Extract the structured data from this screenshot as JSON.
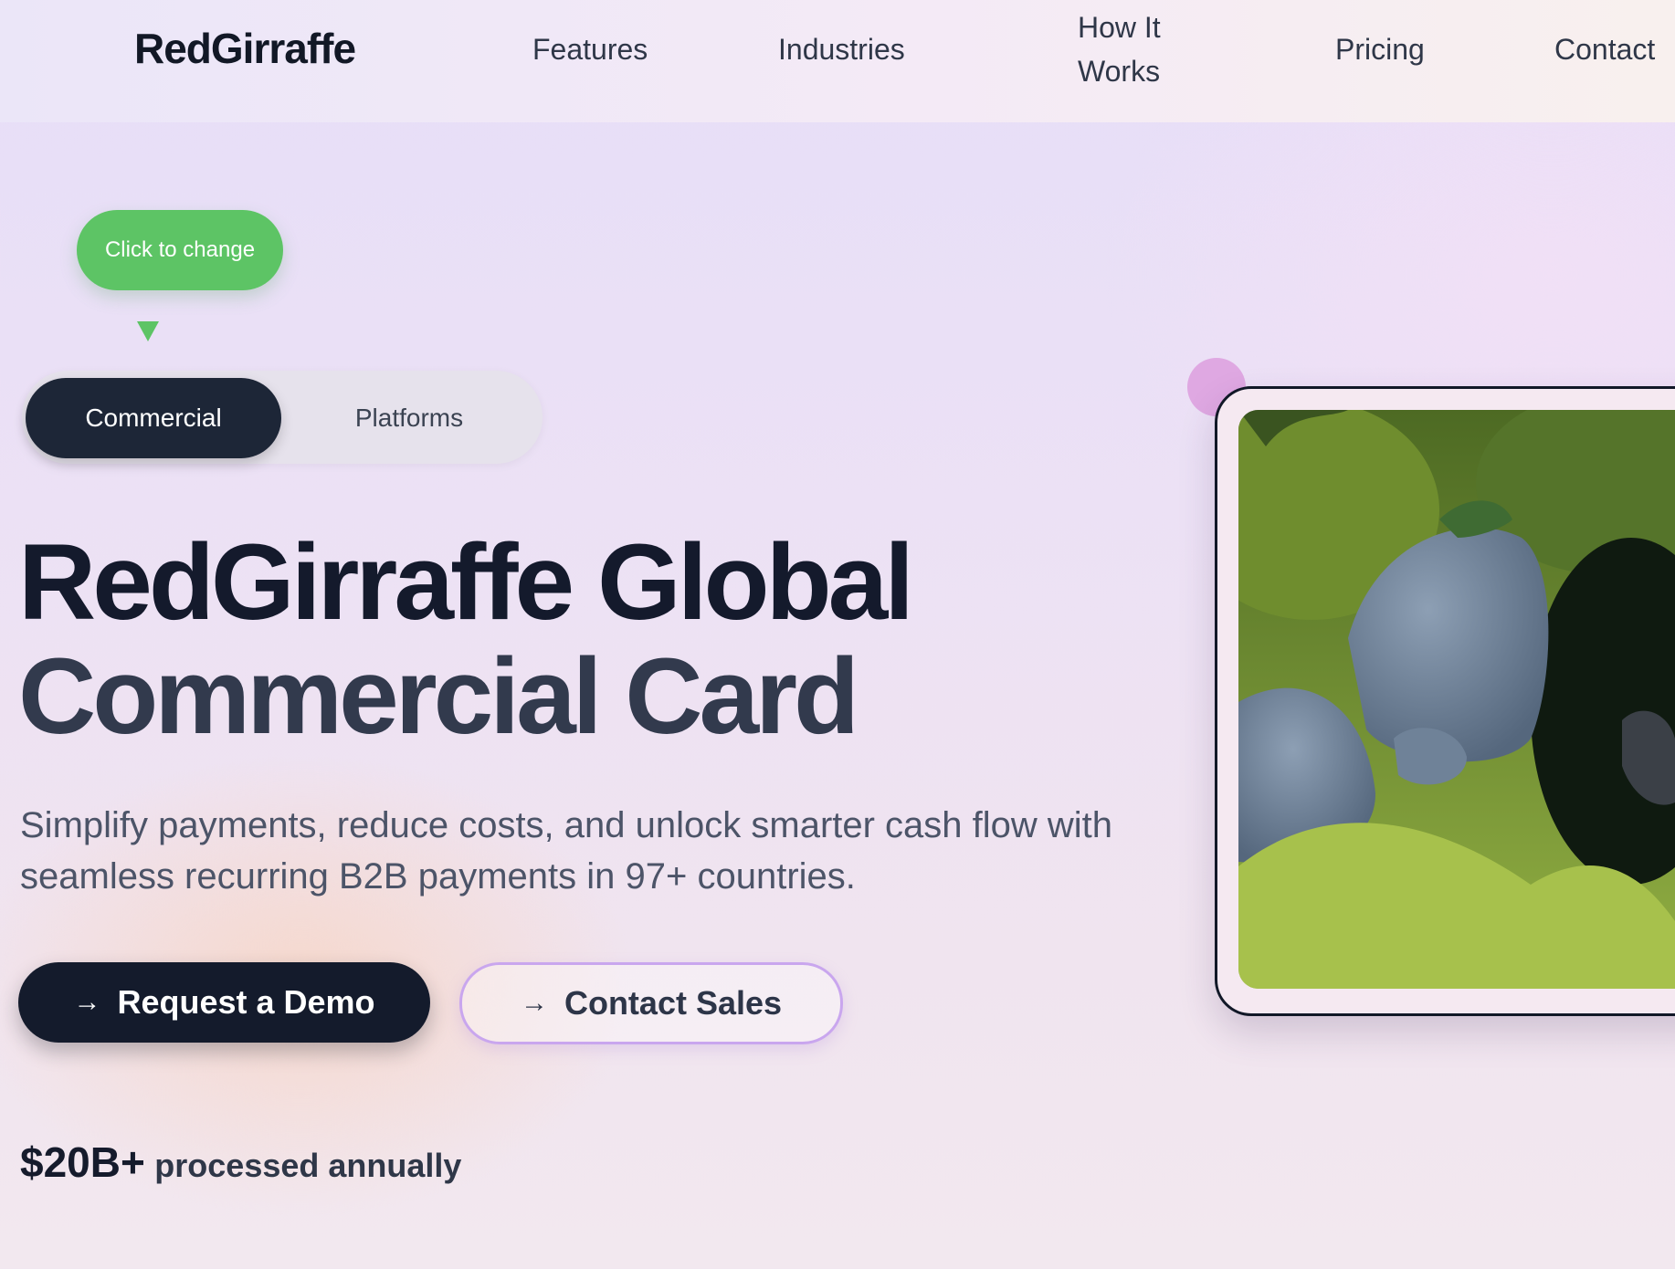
{
  "nav": {
    "brand": "RedGirraffe",
    "links": [
      "Features",
      "Industries",
      "How It",
      "Works",
      "Pricing",
      "Contact"
    ]
  },
  "tooltip": {
    "label": "Click to change"
  },
  "toggle": {
    "options": [
      "Commercial",
      "Platforms"
    ],
    "selected": "Commercial"
  },
  "hero": {
    "title_line1": "RedGirraffe Global",
    "title_line2": "Commercial Card",
    "subtitle": "Simplify payments, reduce costs, and unlock smarter cash flow with seamless recurring B2B payments in 97+ countries.",
    "primary_cta": "Request a Demo",
    "secondary_cta": "Contact Sales",
    "arrow_glyph": "→",
    "stat_value": "$20B+",
    "stat_label": "processed annually"
  },
  "colors": {
    "tooltip_green": "#5dc465",
    "dark": "#141b2c",
    "secondary_border": "#c9a6ee",
    "accent_dot": "#dfa8e2"
  },
  "media": {
    "icon": "nature-video-frame"
  }
}
